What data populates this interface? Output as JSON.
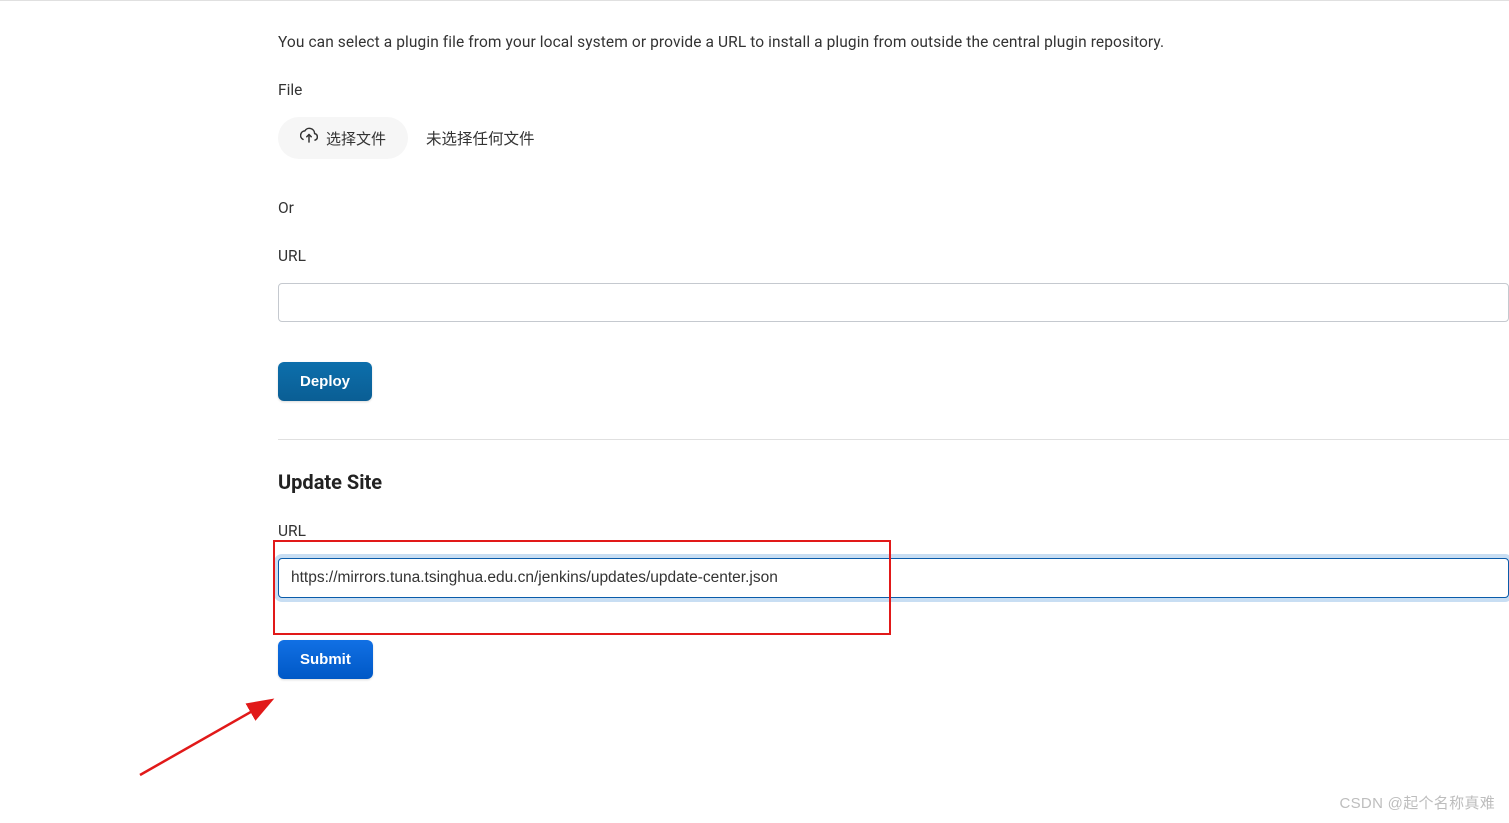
{
  "deploy_section": {
    "description": "You can select a plugin file from your local system or provide a URL to install a plugin from outside the central plugin repository.",
    "file_label": "File",
    "choose_file_button": "选择文件",
    "file_status": "未选择任何文件",
    "or_label": "Or",
    "url_label": "URL",
    "url_value": "",
    "deploy_button": "Deploy"
  },
  "update_site": {
    "heading": "Update Site",
    "url_label": "URL",
    "url_value": "https://mirrors.tuna.tsinghua.edu.cn/jenkins/updates/update-center.json",
    "submit_button": "Submit"
  },
  "watermark": "CSDN @起个名称真难"
}
